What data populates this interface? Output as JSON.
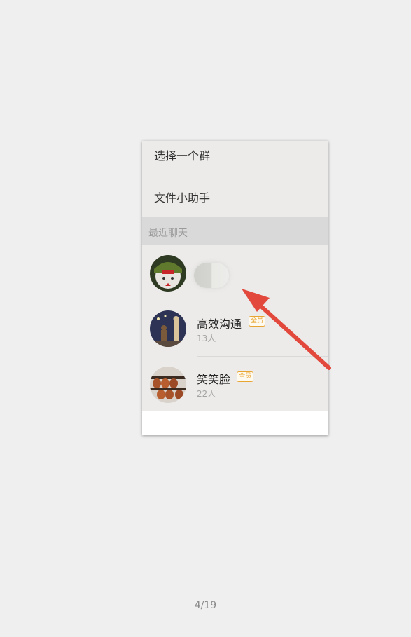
{
  "menu": {
    "select_group": "选择一个群",
    "file_helper": "文件小助手"
  },
  "recent": {
    "header": "最近聊天",
    "chats": [
      {
        "name": "",
        "count": "",
        "badge": ""
      },
      {
        "name": "高效沟通",
        "badge": "全员",
        "count": "13人"
      },
      {
        "name": "笑笑脸",
        "badge": "全员",
        "count": "22人"
      }
    ]
  },
  "footer": {
    "page_indicator": "4/19"
  },
  "colors": {
    "badge": "#e8a532",
    "arrow": "#e2483c",
    "header_bg": "#d9d9d9"
  }
}
